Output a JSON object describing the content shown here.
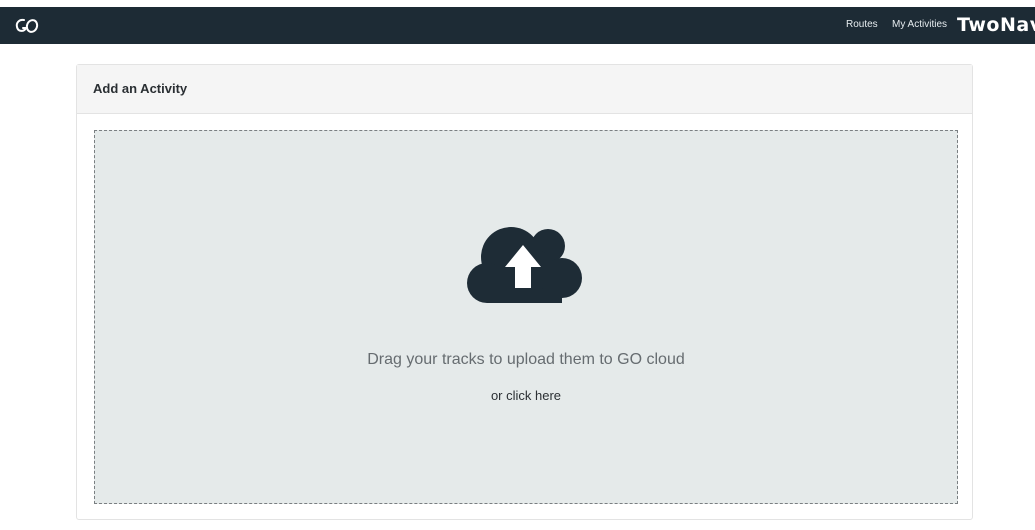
{
  "header": {
    "logo_icon": "go-logo-icon",
    "nav": {
      "routes_label": "Routes",
      "activities_label": "My Activities"
    },
    "brand_name": "TwoNav",
    "background_color": "#1d2b35"
  },
  "panel": {
    "title": "Add an Activity",
    "dropzone": {
      "icon": "cloud-upload-icon",
      "drag_text": "Drag your tracks to upload them to GO cloud",
      "click_text": "or click here",
      "background_color": "#e5eaea"
    }
  }
}
